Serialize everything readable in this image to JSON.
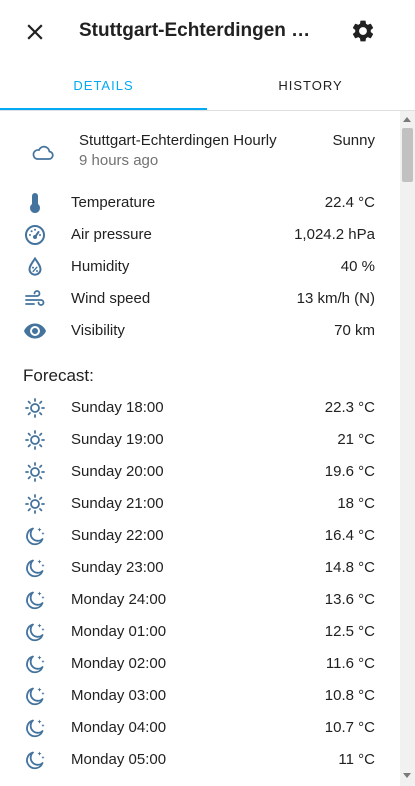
{
  "header": {
    "title": "Stuttgart-Echterdingen Hou…"
  },
  "tabs": [
    {
      "label": "DETAILS",
      "active": true
    },
    {
      "label": "HISTORY",
      "active": false
    }
  ],
  "current": {
    "name": "Stuttgart-Echterdingen Hourly",
    "updated": "9 hours ago",
    "state": "Sunny",
    "icon": "cloud-icon"
  },
  "attributes": [
    {
      "icon": "thermometer-icon",
      "label": "Temperature",
      "value": "22.4 °C"
    },
    {
      "icon": "gauge-icon",
      "label": "Air pressure",
      "value": "1,024.2 hPa"
    },
    {
      "icon": "humidity-icon",
      "label": "Humidity",
      "value": "40 %"
    },
    {
      "icon": "wind-icon",
      "label": "Wind speed",
      "value": "13 km/h (N)"
    },
    {
      "icon": "eye-icon",
      "label": "Visibility",
      "value": "70 km"
    }
  ],
  "forecast_heading": "Forecast:",
  "forecast": [
    {
      "icon": "sunny-icon",
      "time": "Sunday 18:00",
      "temp": "22.3 °C"
    },
    {
      "icon": "sunny-icon",
      "time": "Sunday 19:00",
      "temp": "21 °C"
    },
    {
      "icon": "sunny-icon",
      "time": "Sunday 20:00",
      "temp": "19.6 °C"
    },
    {
      "icon": "sunny-icon",
      "time": "Sunday 21:00",
      "temp": "18 °C"
    },
    {
      "icon": "night-icon",
      "time": "Sunday 22:00",
      "temp": "16.4 °C"
    },
    {
      "icon": "night-icon",
      "time": "Sunday 23:00",
      "temp": "14.8 °C"
    },
    {
      "icon": "night-icon",
      "time": "Monday 24:00",
      "temp": "13.6 °C"
    },
    {
      "icon": "night-icon",
      "time": "Monday 01:00",
      "temp": "12.5 °C"
    },
    {
      "icon": "night-icon",
      "time": "Monday 02:00",
      "temp": "11.6 °C"
    },
    {
      "icon": "night-icon",
      "time": "Monday 03:00",
      "temp": "10.8 °C"
    },
    {
      "icon": "night-icon",
      "time": "Monday 04:00",
      "temp": "10.7 °C"
    },
    {
      "icon": "night-icon",
      "time": "Monday 05:00",
      "temp": "11 °C"
    }
  ],
  "colors": {
    "accent": "#03a9f4",
    "icon": "#44739e",
    "text": "#212121",
    "secondary_text": "#727272"
  }
}
